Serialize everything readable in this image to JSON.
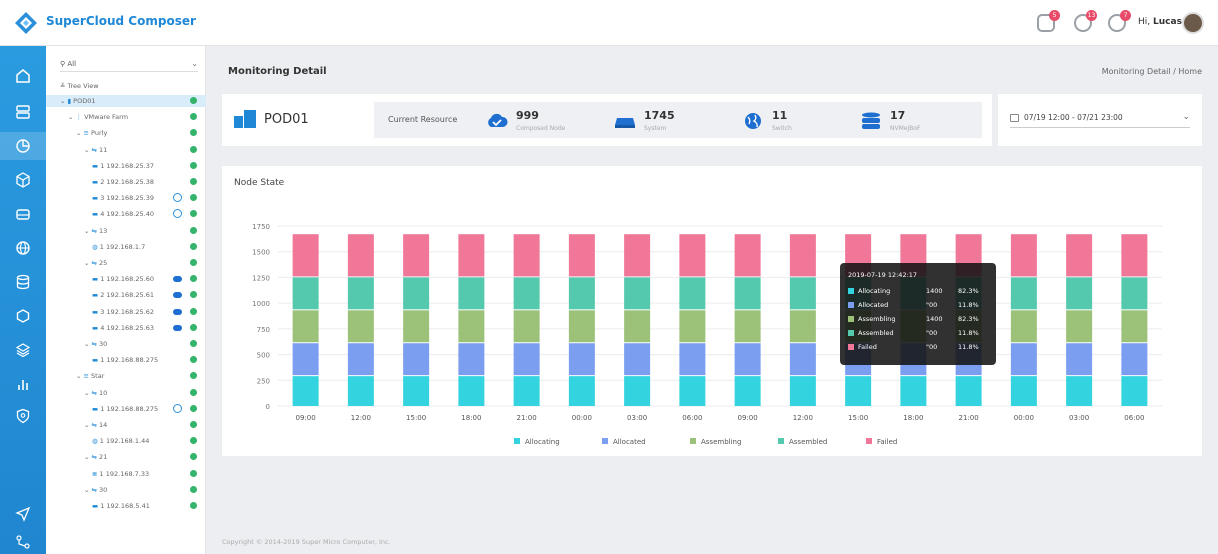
{
  "app": {
    "title": "SuperCloud Composer"
  },
  "header": {
    "badges": [
      "5",
      "13",
      "7"
    ],
    "greeting": "Hi,",
    "user": "Lucas"
  },
  "tree": {
    "filter": "All",
    "view_label": "Tree View",
    "rows": [
      {
        "label": "POD01",
        "depth": 0,
        "icon": "pod-icon",
        "selected": true
      },
      {
        "label": "VMware Farm",
        "depth": 1,
        "icon": "vmware-icon"
      },
      {
        "label": "Purly",
        "depth": 2,
        "icon": "rack-icon"
      },
      {
        "label": "11",
        "depth": 3,
        "icon": "switch-icon"
      },
      {
        "label": "1  192.168.25.37",
        "depth": 4,
        "icon": "server-icon"
      },
      {
        "label": "2  192.168.25.38",
        "depth": 4,
        "icon": "server-icon"
      },
      {
        "label": "3  192.168.25.39",
        "depth": 4,
        "icon": "server-icon",
        "extra": "nvme"
      },
      {
        "label": "4  192.168.25.40",
        "depth": 4,
        "icon": "server-icon",
        "extra": "globe"
      },
      {
        "label": "13",
        "depth": 3,
        "icon": "switch-icon"
      },
      {
        "label": "1  192.168.1.7",
        "depth": 4,
        "icon": "globe-icon"
      },
      {
        "label": "25",
        "depth": 3,
        "icon": "switch-icon"
      },
      {
        "label": "1  192.168.25.60",
        "depth": 4,
        "icon": "server-icon",
        "extra": "cloud"
      },
      {
        "label": "2  192.168.25.61",
        "depth": 4,
        "icon": "server-icon",
        "extra": "cloud"
      },
      {
        "label": "3  192.168.25.62",
        "depth": 4,
        "icon": "server-icon",
        "extra": "cloud"
      },
      {
        "label": "4  192.168.25.63",
        "depth": 4,
        "icon": "server-icon",
        "extra": "cloud"
      },
      {
        "label": "30",
        "depth": 3,
        "icon": "switch-icon"
      },
      {
        "label": "1  192.168.88.275",
        "depth": 4,
        "icon": "server-icon"
      },
      {
        "label": "Star",
        "depth": 2,
        "icon": "rack-icon"
      },
      {
        "label": "10",
        "depth": 3,
        "icon": "switch-icon"
      },
      {
        "label": "1  192.168.88.275",
        "depth": 4,
        "icon": "server-icon",
        "extra": "globe"
      },
      {
        "label": "14",
        "depth": 3,
        "icon": "switch-icon"
      },
      {
        "label": "1  192.168.1.44",
        "depth": 4,
        "icon": "globe-icon"
      },
      {
        "label": "21",
        "depth": 3,
        "icon": "switch-icon"
      },
      {
        "label": "1  192.168.7.33",
        "depth": 4,
        "icon": "storage-icon"
      },
      {
        "label": "30",
        "depth": 3,
        "icon": "switch-icon"
      },
      {
        "label": "1  192.168.5.41",
        "depth": 4,
        "icon": "server-icon"
      }
    ]
  },
  "page": {
    "title": "Monitoring Detail",
    "breadcrumb": "Monitoring Detail / Home"
  },
  "resource": {
    "pod": "POD01",
    "title": "Current Resource",
    "stats": [
      {
        "value": "999",
        "label": "Composed Node",
        "icon": "cloud-check-icon"
      },
      {
        "value": "1745",
        "label": "System",
        "icon": "server-icon"
      },
      {
        "value": "11",
        "label": "Switch",
        "icon": "globe-icon"
      },
      {
        "value": "17",
        "label": "NVMeJBoF",
        "icon": "database-icon"
      }
    ]
  },
  "date_range": "07/19 12:00 - 07/21 23:00",
  "chart_title": "Node State",
  "colors": {
    "Allocating": "#33d4e0",
    "Allocated": "#7b9ef0",
    "Assembling": "#9cc27a",
    "Assembled": "#55c9ad",
    "Failed": "#f07798",
    "accent": "#1e88d6"
  },
  "chart_data": {
    "type": "bar",
    "stacked": true,
    "title": "Node State",
    "categories": [
      "09:00",
      "12:00",
      "15:00",
      "18:00",
      "21:00",
      "00:00",
      "03:00",
      "06:00",
      "09:00",
      "12:00",
      "15:00",
      "18:00",
      "21:00",
      "00:00",
      "03:00",
      "06:00"
    ],
    "series": [
      {
        "name": "Allocating",
        "values": [
          300,
          300,
          300,
          300,
          300,
          300,
          300,
          300,
          300,
          300,
          300,
          300,
          300,
          300,
          300,
          300
        ]
      },
      {
        "name": "Allocated",
        "values": [
          320,
          320,
          320,
          320,
          320,
          320,
          320,
          320,
          320,
          320,
          320,
          320,
          320,
          320,
          320,
          320
        ]
      },
      {
        "name": "Assembling",
        "values": [
          320,
          320,
          320,
          320,
          320,
          320,
          320,
          320,
          320,
          320,
          320,
          320,
          320,
          320,
          320,
          320
        ]
      },
      {
        "name": "Assembled",
        "values": [
          320,
          320,
          320,
          320,
          320,
          320,
          320,
          320,
          320,
          320,
          320,
          320,
          320,
          320,
          320,
          320
        ]
      },
      {
        "name": "Failed",
        "values": [
          420,
          420,
          420,
          420,
          420,
          420,
          420,
          420,
          420,
          420,
          420,
          420,
          420,
          420,
          420,
          420
        ]
      }
    ],
    "ylim": [
      0,
      1750
    ],
    "yticks": [
      0,
      250,
      500,
      750,
      1000,
      1250,
      1500,
      1750
    ],
    "legend": "bottom"
  },
  "tooltip": {
    "date": "2019-07-19 12:42:17",
    "rows": [
      {
        "name": "Allocating",
        "count": "1400",
        "pct": "82.3%"
      },
      {
        "name": "Allocated",
        "count": "\"00",
        "pct": "11.8%"
      },
      {
        "name": "Assembling",
        "count": "1400",
        "pct": "82.3%"
      },
      {
        "name": "Assembled",
        "count": "\"00",
        "pct": "11.8%"
      },
      {
        "name": "Failed",
        "count": "\"00",
        "pct": "11.8%"
      }
    ]
  },
  "footer": "Copyright © 2014-2019 Super Micro Computer, Inc."
}
